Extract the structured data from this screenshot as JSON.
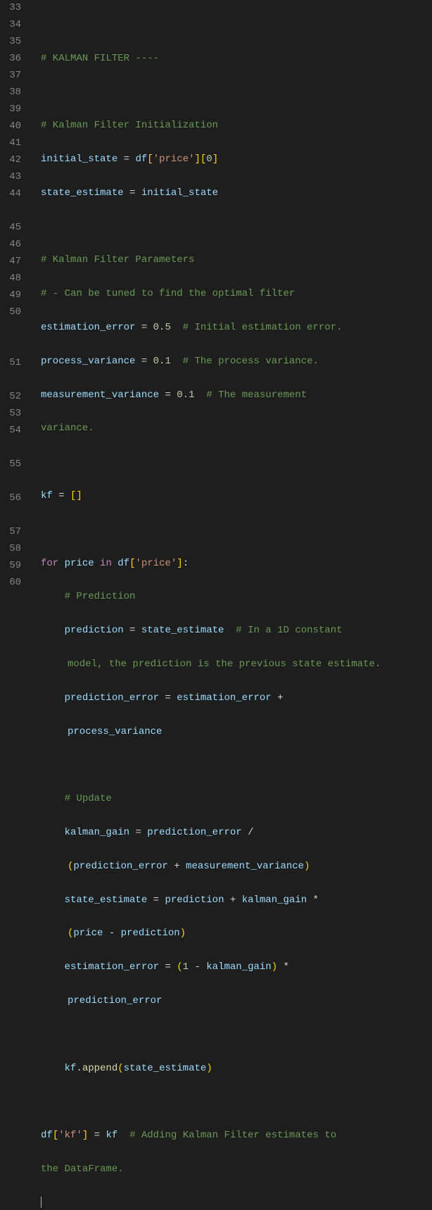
{
  "gutter": {
    "start": 33,
    "end": 60
  },
  "code": {
    "l34_cmt": "# KALMAN FILTER ----",
    "l36_cmt": "# Kalman Filter Initialization",
    "l37_var1": "initial_state",
    "l37_var2": "df",
    "l37_str": "'price'",
    "l37_num": "0",
    "l38_var1": "state_estimate",
    "l38_var2": "initial_state",
    "l40_cmt": "# Kalman Filter Parameters",
    "l41_cmt": "# - Can be tuned to find the optimal filter",
    "l42_var": "estimation_error",
    "l42_num": "0.5",
    "l42_cmt": "# Initial estimation error.",
    "l43_var": "process_variance",
    "l43_num": "0.1",
    "l43_cmt": "# The process variance.",
    "l44_var": "measurement_variance",
    "l44_num": "0.1",
    "l44_cmt": "# The measurement ",
    "l44_cmt_wrap": "variance.",
    "l46_var": "kf",
    "l48_for": "for",
    "l48_var1": "price",
    "l48_in": "in",
    "l48_var2": "df",
    "l48_str": "'price'",
    "l49_cmt": "# Prediction",
    "l50_var1": "prediction",
    "l50_var2": "state_estimate",
    "l50_cmt": "# In a 1D constant ",
    "l50_cmt_wrap": "model, the prediction is the previous state estimate.",
    "l51_var1": "prediction_error",
    "l51_var2": "estimation_error",
    "l51_var3": "process_variance",
    "l53_cmt": "# Update",
    "l54_var1": "kalman_gain",
    "l54_var2": "prediction_error",
    "l54_var3": "prediction_error",
    "l54_var4": "measurement_variance",
    "l55_var1": "state_estimate",
    "l55_var2": "prediction",
    "l55_var3": "kalman_gain",
    "l55_var4": "price",
    "l55_var5": "prediction",
    "l56_var1": "estimation_error",
    "l56_num": "1",
    "l56_var2": "kalman_gain",
    "l56_var3": "prediction_error",
    "l58_var1": "kf",
    "l58_fn": "append",
    "l58_var2": "state_estimate",
    "l60_var1": "df",
    "l60_str": "'kf'",
    "l60_var2": "kf",
    "l60_cmt": "# Adding Kalman Filter estimates to ",
    "l60_cmt_wrap": "the DataFrame."
  }
}
